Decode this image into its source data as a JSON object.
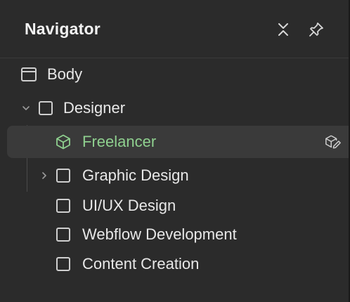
{
  "navigator": {
    "title": "Navigator"
  },
  "tree": {
    "body": {
      "label": "Body"
    },
    "designer": {
      "label": "Designer",
      "expanded": true
    },
    "freelancer": {
      "label": "Freelancer",
      "selected": true
    },
    "graphic_design": {
      "label": "Graphic Design",
      "expanded": false
    },
    "uiux_design": {
      "label": "UI/UX Design"
    },
    "webflow_dev": {
      "label": "Webflow Development"
    },
    "content_creation": {
      "label": "Content Creation"
    }
  },
  "icons": {
    "collapse": "collapse-icon",
    "pin": "pin-icon",
    "body": "body-icon",
    "component": "component-icon",
    "edit_component": "edit-component-icon"
  },
  "colors": {
    "background": "#2b2b2b",
    "selected_row": "#3a3a3a",
    "selected_text": "#8fd08f",
    "text": "#e8e8e8"
  }
}
